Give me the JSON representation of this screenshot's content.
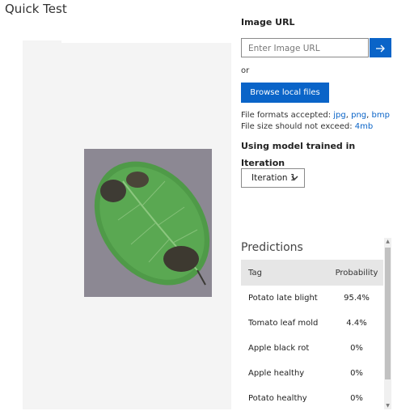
{
  "header": {
    "title": "Quick Test"
  },
  "image_url": {
    "label": "Image URL",
    "placeholder": "Enter Image URL"
  },
  "or_text": "or",
  "browse_label": "Browse local files",
  "formats": {
    "prefix": "File formats accepted: ",
    "jpg": "jpg",
    "sep1": ", ",
    "png": "png",
    "sep2": ", ",
    "bmp": "bmp",
    "size_prefix": "File size should not exceed: ",
    "size": "4mb"
  },
  "model": {
    "heading": "Using model trained in",
    "iteration_label": "Iteration",
    "iteration_selected": "Iteration 1"
  },
  "predictions": {
    "title": "Predictions",
    "headers": {
      "tag": "Tag",
      "probability": "Probability"
    },
    "rows": [
      {
        "tag": "Potato late blight",
        "probability": "95.4%"
      },
      {
        "tag": "Tomato leaf mold",
        "probability": "4.4%"
      },
      {
        "tag": "Apple black rot",
        "probability": "0%"
      },
      {
        "tag": "Apple healthy",
        "probability": "0%"
      },
      {
        "tag": "Potato healthy",
        "probability": "0%"
      }
    ]
  },
  "colors": {
    "accent": "#0a64c8",
    "table_header": "#e6e6e6",
    "preview_bg": "#f4f4f4"
  },
  "icons": {
    "submit": "arrow-right-icon",
    "dropdown": "chevron-down-icon"
  }
}
